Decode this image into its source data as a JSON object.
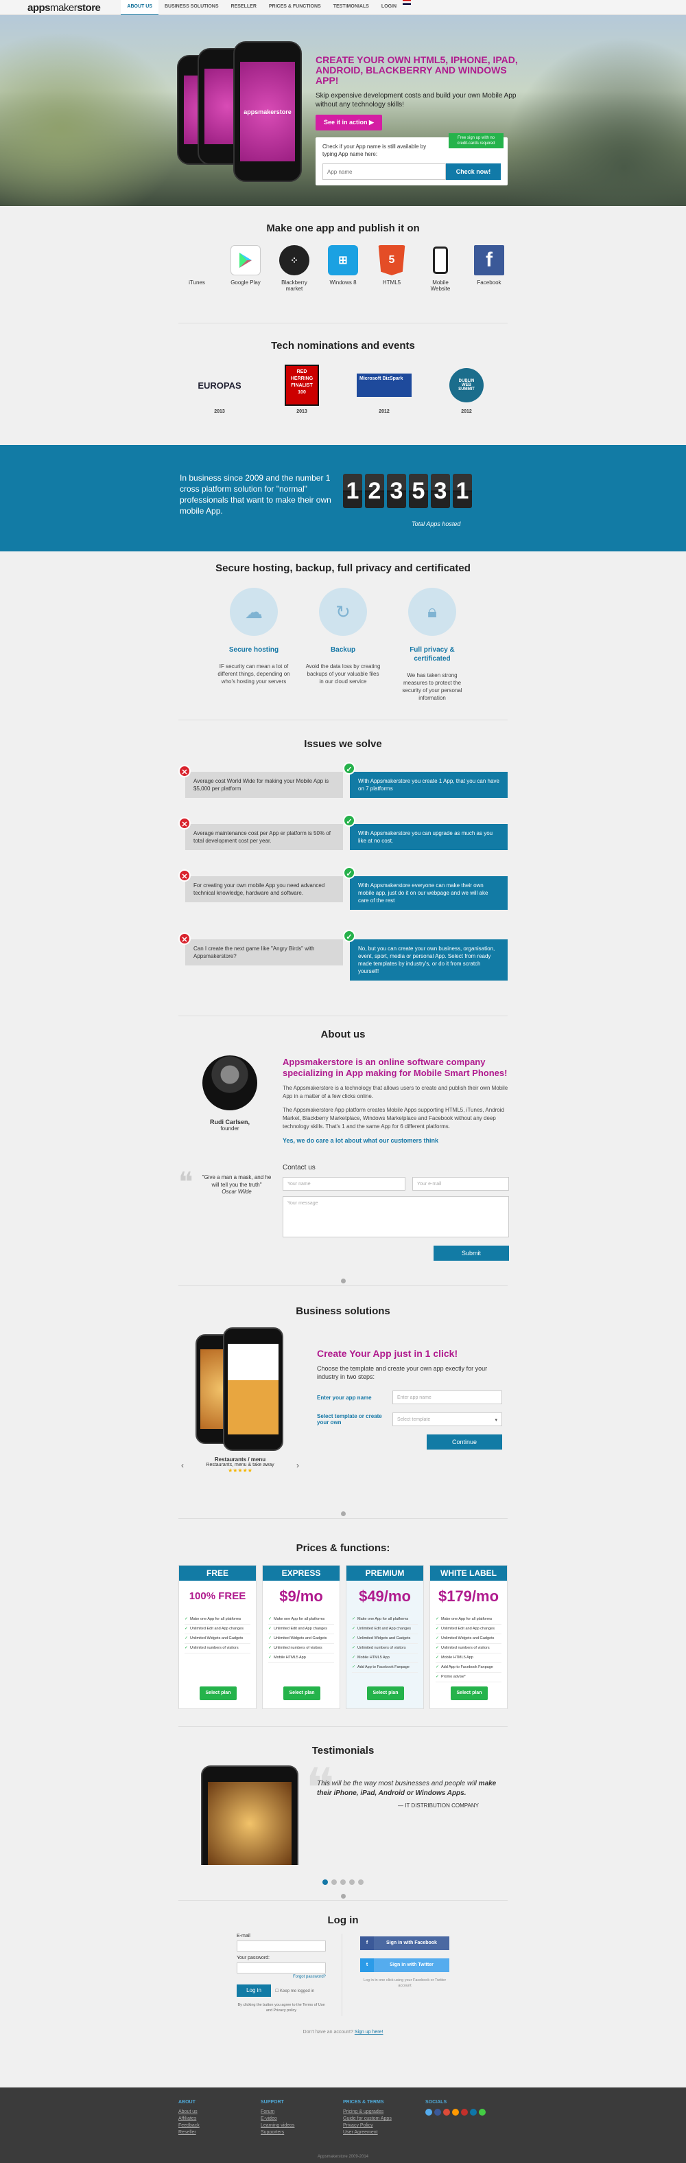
{
  "topbar": {
    "logo_bold": "apps",
    "logo_rest": "maker",
    "logo_bold2": "store",
    "nav": [
      "ABOUT US",
      "BUSINESS SOLUTIONS",
      "RESELLER",
      "PRICES & FUNCTIONS",
      "TESTIMONIALS",
      "LOGIN"
    ]
  },
  "hero": {
    "phone_label": "appsmakerstore",
    "title": "CREATE YOUR OWN HTML5, IPHONE, IPAD, ANDROID, BLACKBERRY AND WINDOWS APP!",
    "subtitle": "Skip expensive development costs and build your own Mobile App without any technology skills!",
    "cta": "See it in action",
    "check_text": "Check if your App name is still available by typing App name here:",
    "badge": "Free sign up with no credit-cards required",
    "input_placeholder": "App name",
    "check_button": "Check now!"
  },
  "platforms": {
    "title": "Make one app and publish it on",
    "items": [
      {
        "label": "iTunes",
        "icon": "apple-icon",
        "color": "#111"
      },
      {
        "label": "Google Play",
        "icon": "google-play-icon",
        "color": "#eee"
      },
      {
        "label": "Blackberry market",
        "icon": "blackberry-icon",
        "color": "#222"
      },
      {
        "label": "Windows 8",
        "icon": "windows-icon",
        "color": "#1ba1e2"
      },
      {
        "label": "HTML5",
        "icon": "html5-icon",
        "color": "#e44d26"
      },
      {
        "label": "Mobile Website",
        "icon": "mobile-icon",
        "color": "#222"
      },
      {
        "label": "Facebook",
        "icon": "facebook-icon",
        "color": "#3b5998"
      }
    ]
  },
  "nominations": {
    "title": "Tech nominations and events",
    "items": [
      {
        "name": "EUROPAS",
        "year": "2013"
      },
      {
        "name": "RED HERRING FINALIST 100",
        "year": "2013"
      },
      {
        "name": "Microsoft BizSpark",
        "year": "2012"
      },
      {
        "name": "DUBLIN WEB SUMMIT",
        "year": "2012"
      }
    ]
  },
  "stats": {
    "text": "In business since 2009 and the number 1 cross platform solution for \"normal\" professionals that want to make their own mobile App.",
    "digits": [
      "1",
      "2",
      "3",
      "5",
      "3",
      "1"
    ],
    "caption": "Total Apps hosted"
  },
  "secure": {
    "title": "Secure hosting, backup, full privacy and certificated",
    "items": [
      {
        "title": "Secure hosting",
        "icon": "cloud-icon",
        "text": "IF security can mean a lot of different things, depending on who's hosting your servers"
      },
      {
        "title": "Backup",
        "icon": "refresh-icon",
        "text": "Avoid the data loss by creating backups of your valuable files in our cloud service"
      },
      {
        "title": "Full privacy & certificated",
        "icon": "lock-icon",
        "text": "We has taken strong measures to protect the security of your personal information"
      }
    ]
  },
  "issues": {
    "title": "Issues we solve",
    "items": [
      {
        "bad": "Average cost World Wide for making your Mobile App is $5,000 per platform",
        "good": "With Appsmakerstore you create 1 App, that you can have on 7 platforms"
      },
      {
        "bad": "Average maintenance cost per App er platform is 50% of total development cost per year.",
        "good": "With Appsmakerstore you can upgrade as much as you like at no cost."
      },
      {
        "bad": "For creating your own mobile App you need advanced technical knowledge, hardware and software.",
        "good": "With Appsmakerstore everyone can make their own mobile app, just do it on our webpage and we will  ake care of the rest"
      },
      {
        "bad": "Can I create the next game like \"Angry Birds\" with Appsmakerstore?",
        "good": "No, but you can create your own business, organisation, event, sport, media or personal App. Select from ready made templates by industry's, or do it from scratch yourself!"
      }
    ]
  },
  "about": {
    "title": "About us",
    "name": "Rudi Carlsen,",
    "role": "founder",
    "headline": "Appsmakerstore is an online software company specializing in App making for Mobile Smart Phones!",
    "p1": "The Appsmakerstore is a technology that allows users to create and publish their own Mobile App in a matter of a few clicks online.",
    "p2": "The Appsmakerstore App platform creates Mobile Apps supporting HTML5, iTunes, Android Market, Blackberry Marketplace, Windows Marketplace and Facebook without any deep technology skills. That's 1 and the same App for 6 different platforms.",
    "tagline": "Yes, we do care a lot about what our customers think",
    "quote": "\"Give a man a mask, and he will tell you the truth\"",
    "quote_author": "Oscar Wilde",
    "contact_title": "Contact us",
    "name_ph": "Your name",
    "email_ph": "Your e-mail",
    "msg_ph": "Your message",
    "submit": "Submit"
  },
  "business": {
    "title": "Business solutions",
    "headline": "Create Your App  just in 1 click!",
    "text": "Choose the template and create your own app exectly for your industry in two steps:",
    "label1": "Enter your app name",
    "ph1": "Enter app name",
    "label2": "Select template or create your own",
    "ph2": "Select template",
    "btn": "Continue",
    "caption_title": "Restaurants / menu",
    "caption_sub": "Restaurants, menu & take away",
    "stars": "★★★★★"
  },
  "pricing": {
    "title": "Prices & functions:",
    "plans": [
      {
        "name": "FREE",
        "price": "100% FREE",
        "features": [
          "Make one App for all platforms",
          "Unlimited Edit and App changes",
          "Unlimited Widgets and Gadgets",
          "Unlimited numbers of visitors"
        ],
        "btn": "Select plan"
      },
      {
        "name": "EXPRESS",
        "price": "$9/mo",
        "features": [
          "Make one App for all platforms",
          "Unlimited Edit and App changes",
          "Unlimited Widgets and Gadgets",
          "Unlimited numbers of visitors",
          "Mobile HTML5 App"
        ],
        "btn": "Select plan"
      },
      {
        "name": "PREMIUM",
        "price": "$49/mo",
        "features": [
          "Make one App for all platforms",
          "Unlimited Edit and App changes",
          "Unlimited Widgets and Gadgets",
          "Unlimited numbers of visitors",
          "Mobile HTML5 App",
          "Add App to Facebook Fanpage"
        ],
        "btn": "Select plan"
      },
      {
        "name": "WHITE LABEL",
        "price": "$179/mo",
        "features": [
          "Make one App for all platforms",
          "Unlimited Edit and App changes",
          "Unlimited Widgets and Gadgets",
          "Unlimited numbers of visitors",
          "Mobile HTML5 App",
          "Add App to Facebook Fanpage",
          "Promo advise*"
        ],
        "btn": "Select plan"
      }
    ]
  },
  "testimonials": {
    "title": "Testimonials",
    "text1": "This will be the way most businesses and people will ",
    "text_bold": "make their iPhone, iPad, Android or Windows Apps.",
    "author": "— IT DISTRIBUTION COMPANY"
  },
  "login": {
    "title": "Log in",
    "email_label": "E-mail",
    "pw_label": "Your password:",
    "forgot": "Forgot password?",
    "btn": "Log in",
    "keep": "Keep me logged in",
    "terms": "By clicking the button you agree to the Terms of Use and Privacy policy",
    "fb": "Sign in with Facebook",
    "tw": "Sign in with Twitter",
    "social_note": "Log in in one click using your Facebook or Twitter account",
    "no_account": "Don't have an account?",
    "signup": "Sign up here!"
  },
  "footer": {
    "cols": [
      {
        "h": "ABOUT",
        "links": [
          "About us",
          "Affiliates",
          "Feedback",
          "Reseller"
        ]
      },
      {
        "h": "SUPPORT",
        "links": [
          "Forum",
          "E-video",
          "Learning videos",
          "Supporters"
        ]
      },
      {
        "h": "PRICES & TERMS",
        "links": [
          "Pricing & upgrades",
          "Guide for custom Apps",
          "Privacy Policy",
          "User Agreement"
        ]
      },
      {
        "h": "SOCIALS",
        "links": []
      }
    ],
    "copyright": "Appsmakerstore 2009-2014"
  }
}
